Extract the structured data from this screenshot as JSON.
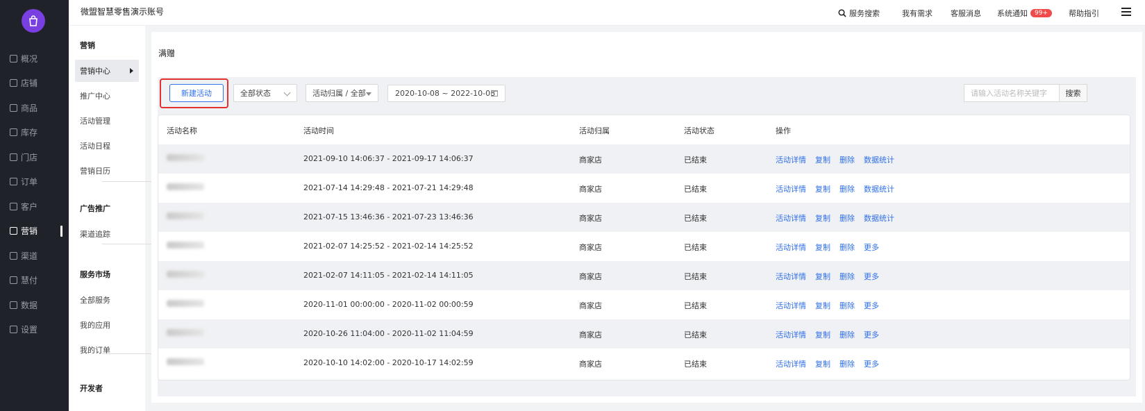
{
  "header": {
    "brand": "微盟智慧零售演示账号",
    "links": [
      "服务搜索",
      "我有需求",
      "客服消息",
      "系统通知",
      "帮助指引"
    ],
    "notification_badge": "99+"
  },
  "nav": {
    "items": [
      {
        "label": "概况",
        "icon": "overview-icon"
      },
      {
        "label": "店铺",
        "icon": "store-icon"
      },
      {
        "label": "商品",
        "icon": "goods-icon"
      },
      {
        "label": "库存",
        "icon": "inventory-icon"
      },
      {
        "label": "门店",
        "icon": "shop-icon"
      },
      {
        "label": "订单",
        "icon": "order-icon"
      },
      {
        "label": "客户",
        "icon": "customer-icon"
      },
      {
        "label": "营销",
        "icon": "marketing-icon"
      },
      {
        "label": "渠道",
        "icon": "channel-icon"
      },
      {
        "label": "慧付",
        "icon": "pay-icon"
      },
      {
        "label": "数据",
        "icon": "data-icon"
      },
      {
        "label": "设置",
        "icon": "settings-icon"
      }
    ],
    "active_index": 7
  },
  "subnav": {
    "items": [
      {
        "label": "营销",
        "type": "group"
      },
      {
        "label": "营销中心",
        "type": "active"
      },
      {
        "label": "推广中心",
        "type": "item"
      },
      {
        "label": "活动管理",
        "type": "item"
      },
      {
        "label": "活动日程",
        "type": "item"
      },
      {
        "label": "营销日历",
        "type": "item"
      },
      {
        "label": "广告推广",
        "type": "group"
      },
      {
        "label": "渠道追踪",
        "type": "item"
      },
      {
        "label": "服务市场",
        "type": "group"
      },
      {
        "label": "全部服务",
        "type": "item"
      },
      {
        "label": "我的应用",
        "type": "item"
      },
      {
        "label": "我的订单",
        "type": "item"
      },
      {
        "label": "开发者",
        "type": "group"
      }
    ]
  },
  "page": {
    "title": "满赠",
    "new_button": "新建活动",
    "status_select": "全部状态",
    "ownership_select": "活动归属 / 全部",
    "date_range": "2020-10-08 ~ 2022-10-08",
    "search_placeholder": "请输入活动名称关键字",
    "search_button": "搜索"
  },
  "table": {
    "columns": [
      "活动名称",
      "活动时间",
      "活动归属",
      "活动状态",
      "操作"
    ],
    "rows": [
      {
        "time": "2021-09-10 14:06:37 - 2021-09-17 14:06:37",
        "owner": "商家店",
        "status": "已结束",
        "ops": [
          "活动详情",
          "复制",
          "删除",
          "数据统计"
        ]
      },
      {
        "time": "2021-07-14 14:29:48 - 2021-07-21 14:29:48",
        "owner": "商家店",
        "status": "已结束",
        "ops": [
          "活动详情",
          "复制",
          "删除",
          "数据统计"
        ]
      },
      {
        "time": "2021-07-15 13:46:36 - 2021-07-23 13:46:36",
        "owner": "商家店",
        "status": "已结束",
        "ops": [
          "活动详情",
          "复制",
          "删除",
          "数据统计"
        ]
      },
      {
        "time": "2021-02-07 14:25:52 - 2021-02-14 14:25:52",
        "owner": "商家店",
        "status": "已结束",
        "ops": [
          "活动详情",
          "复制",
          "删除",
          "更多"
        ]
      },
      {
        "time": "2021-02-07 14:11:05 - 2021-02-14 14:11:05",
        "owner": "商家店",
        "status": "已结束",
        "ops": [
          "活动详情",
          "复制",
          "删除",
          "更多"
        ]
      },
      {
        "time": "2020-11-01 00:00:00 - 2020-11-02 00:00:59",
        "owner": "商家店",
        "status": "已结束",
        "ops": [
          "活动详情",
          "复制",
          "删除",
          "更多"
        ]
      },
      {
        "time": "2020-10-26 11:04:00 - 2020-11-02 11:04:59",
        "owner": "商家店",
        "status": "已结束",
        "ops": [
          "活动详情",
          "复制",
          "删除",
          "更多"
        ]
      },
      {
        "time": "2020-10-10 14:02:00 - 2020-10-17 14:02:59",
        "owner": "商家店",
        "status": "已结束",
        "ops": [
          "活动详情",
          "复制",
          "删除",
          "更多"
        ]
      }
    ]
  },
  "colors": {
    "nav_bg": "#20222a",
    "accent": "#2f6fe9",
    "highlight": "#e53030",
    "badge": "#f04b4b"
  }
}
